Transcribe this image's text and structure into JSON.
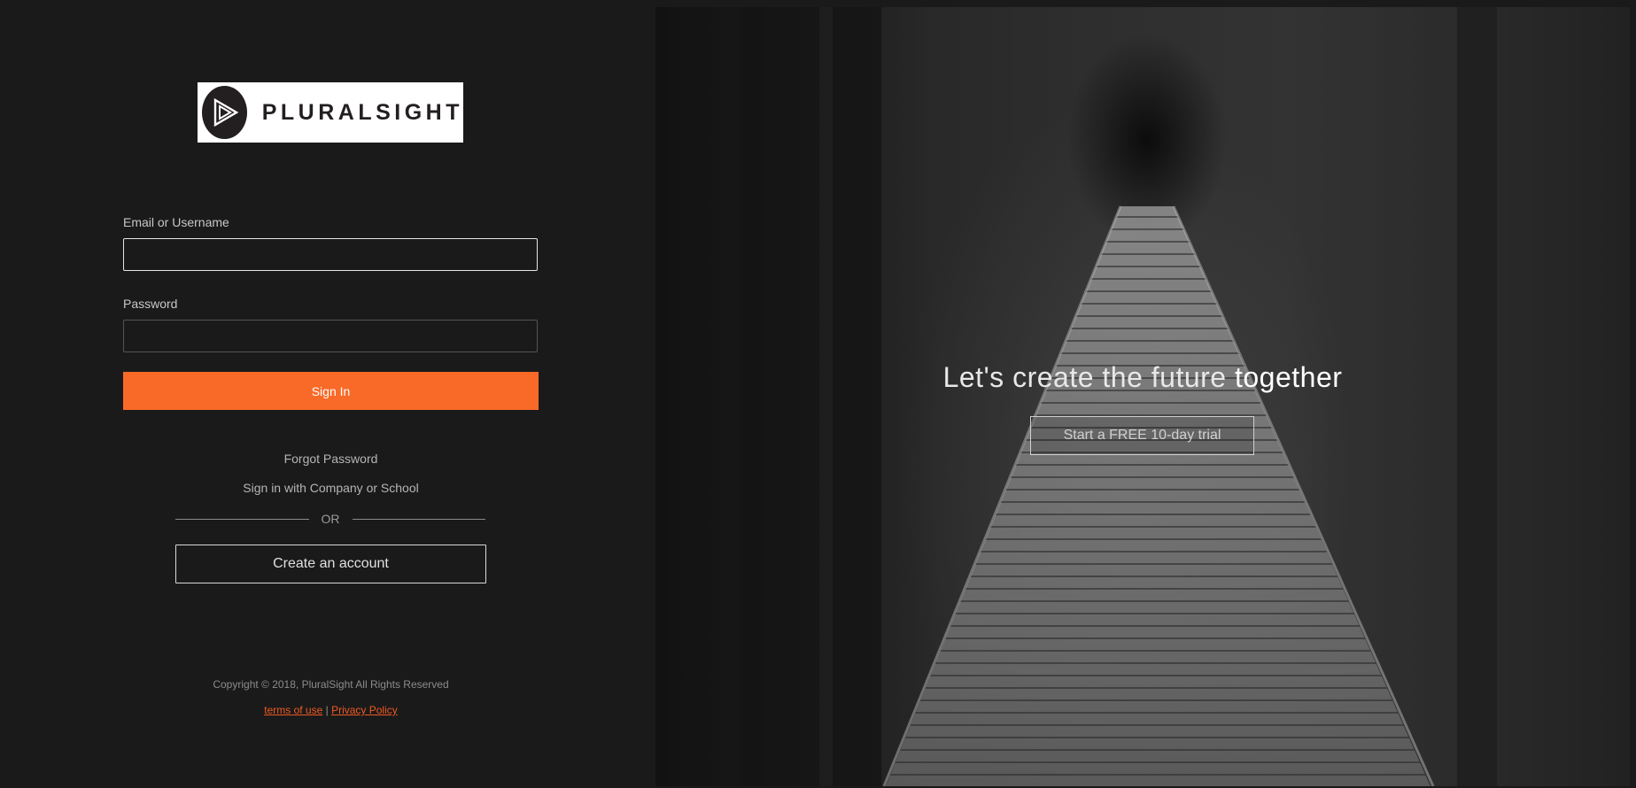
{
  "brand": {
    "name": "PLURALSIGHT",
    "icon": "play-triangle-logo-icon"
  },
  "form": {
    "email_label": "Email or Username",
    "email_value": "",
    "password_label": "Password",
    "password_value": "",
    "signin_label": "Sign In"
  },
  "links": {
    "forgot_password": "Forgot Password",
    "company_signin": "Sign in with Company or School",
    "or_text": "OR",
    "create_account": "Create an account"
  },
  "footer": {
    "copyright": "Copyright © 2018, PluralSight All Rights Reserved",
    "terms": "terms of use",
    "separator": "|",
    "privacy": "Privacy Policy"
  },
  "hero": {
    "headline_light": "Let's create the future",
    "headline_bold": "together",
    "trial_label": "Start a FREE 10-day trial"
  },
  "colors": {
    "accent": "#f96a28",
    "background": "#1a1a1a",
    "link": "#f05a22"
  }
}
